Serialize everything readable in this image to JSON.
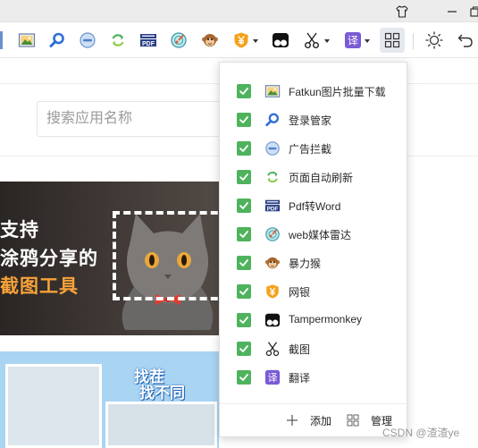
{
  "toolbar": {
    "icons": [
      "fatkun-icon",
      "search-icon",
      "adblock-icon",
      "refresh-icon",
      "pdf-icon",
      "radar-icon",
      "monkey-icon",
      "yen-icon",
      "tampermonkey-icon",
      "scissors-icon",
      "translate-icon",
      "grid-icon",
      "sun-icon",
      "undo-icon"
    ]
  },
  "search": {
    "placeholder": "搜索应用名称"
  },
  "banners": {
    "promo1": {
      "line1": "支持",
      "line2": "涂鸦分享的",
      "line3": "截图工具"
    },
    "promo2": {
      "line1": "找茬",
      "line2": "找不同"
    }
  },
  "panel": {
    "items": [
      {
        "label": "Fatkun图片批量下载",
        "checked": true,
        "icon": "fatkun-icon"
      },
      {
        "label": "登录管家",
        "checked": true,
        "icon": "login-search-icon"
      },
      {
        "label": "广告拦截",
        "checked": true,
        "icon": "adblock-icon"
      },
      {
        "label": "页面自动刷新",
        "checked": true,
        "icon": "refresh-icon"
      },
      {
        "label": "Pdf转Word",
        "checked": true,
        "icon": "pdf-icon"
      },
      {
        "label": "web媒体雷达",
        "checked": true,
        "icon": "radar-icon"
      },
      {
        "label": "暴力猴",
        "checked": true,
        "icon": "monkey-icon"
      },
      {
        "label": "网银",
        "checked": true,
        "icon": "yen-icon"
      },
      {
        "label": "Tampermonkey",
        "checked": true,
        "icon": "tampermonkey-icon"
      },
      {
        "label": "截图",
        "checked": true,
        "icon": "scissors-icon"
      },
      {
        "label": "翻译",
        "checked": true,
        "icon": "translate-icon"
      }
    ],
    "footer": {
      "add_label": "添加",
      "manage_label": "管理"
    }
  },
  "watermark": "CSDN @渣渣ye",
  "colors": {
    "checkbox": "#4eb35c",
    "accent_blue": "#2f6fd6"
  }
}
